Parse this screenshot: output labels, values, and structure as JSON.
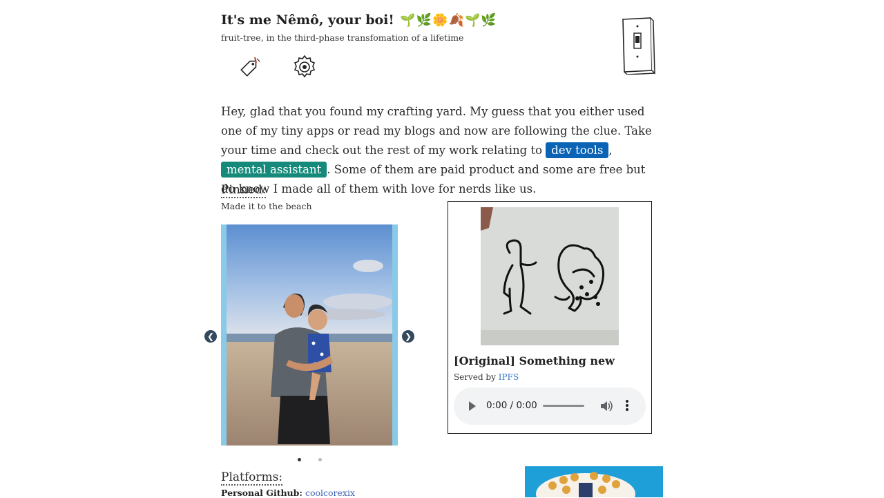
{
  "header": {
    "title": "It's me Nêmô, your boi!",
    "emoji": "🌱🌿🌼🍂🌱🌿",
    "subtitle": "fruit-tree, in the third-phase transfomation of a lifetime"
  },
  "icons": {
    "tag": "tag-icon",
    "gear": "gear-icon",
    "switch": "light-switch-icon"
  },
  "intro": {
    "before": "Hey, glad that you found my crafting yard. My guess that you either used one of my tiny apps or read my blogs and now are following the clue. Take your time and check out the rest of my work relating to ",
    "chip1": "dev tools",
    "sep": ", ",
    "chip2": "mental assistant",
    "after": ". Some of them are paid product and some are free but do know I made all of them with love for nerds like us.",
    "colors": {
      "chip1": "#0b63b5",
      "chip2": "#15897a"
    }
  },
  "pinned": {
    "heading": "Pinned:",
    "caption": "Made it to the beach",
    "carousel": {
      "prev": "❮",
      "next": "❯",
      "active_slide": 1,
      "slide_count": 2
    }
  },
  "card": {
    "title": "[Original] Something new",
    "served_prefix": "Served by ",
    "served_link": "IPFS",
    "audio": {
      "time": "0:00 / 0:00"
    }
  },
  "platforms": {
    "heading": "Platforms:",
    "github_label": "Personal Github:",
    "github_value": "coolcorexix"
  }
}
